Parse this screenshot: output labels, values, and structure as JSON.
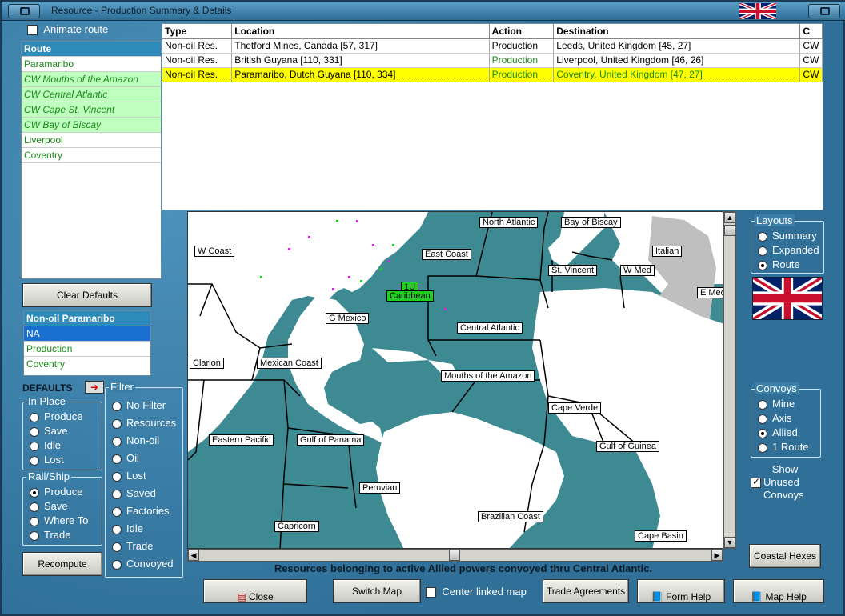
{
  "window": {
    "title": "Resource - Production Summary & Details"
  },
  "animate_route": {
    "label": "Animate route",
    "checked": false
  },
  "route_list": {
    "header": "Route",
    "items": [
      {
        "label": "Paramaribo",
        "style": "plain-green"
      },
      {
        "label": "CW Mouths of the Amazon",
        "style": "convoy"
      },
      {
        "label": "CW Central Atlantic",
        "style": "convoy"
      },
      {
        "label": "CW Cape St. Vincent",
        "style": "convoy"
      },
      {
        "label": "CW Bay of Biscay",
        "style": "convoy"
      },
      {
        "label": "Liverpool",
        "style": "plain-green"
      },
      {
        "label": "Coventry",
        "style": "plain-green"
      }
    ]
  },
  "table": {
    "columns": [
      "Type",
      "Location",
      "Action",
      "Destination",
      "C"
    ],
    "rows": [
      {
        "type": "Non-oil Res.",
        "location": "Thetford Mines, Canada [57, 317]",
        "action": "Production",
        "destination": "Leeds, United Kingdom [45, 27]",
        "c": "CW"
      },
      {
        "type": "Non-oil Res.",
        "location": "British Guyana [110, 331]",
        "action": "Production",
        "destination": "Liverpool, United Kingdom [46, 26]",
        "c": "CW"
      },
      {
        "type": "Non-oil Res.",
        "location": "Paramaribo, Dutch Guyana [110, 334]",
        "action": "Production",
        "destination": "Coventry, United Kingdom [47, 27]",
        "c": "CW"
      }
    ]
  },
  "clear_defaults": "Clear Defaults",
  "info_box": {
    "title": "Non-oil Paramaribo",
    "lines": [
      "NA",
      "Production",
      "Coventry"
    ]
  },
  "defaults_label": "DEFAULTS",
  "in_place": {
    "legend": "In Place",
    "options": [
      "Produce",
      "Save",
      "Idle",
      "Lost"
    ],
    "selected": -1
  },
  "rail_ship": {
    "legend": "Rail/Ship",
    "options": [
      "Produce",
      "Save",
      "Where To",
      "Trade"
    ],
    "selected": 0
  },
  "filter": {
    "legend": "Filter",
    "options": [
      "No Filter",
      "Resources",
      "Non-oil",
      "Oil",
      "Lost",
      "Saved",
      "Factories",
      "Idle",
      "Trade",
      "Convoyed"
    ],
    "selected": -1
  },
  "recompute": "Recompute",
  "layouts": {
    "legend": "Layouts",
    "options": [
      "Summary",
      "Expanded",
      "Route"
    ],
    "selected": 2
  },
  "convoys": {
    "legend": "Convoys",
    "options": [
      "Mine",
      "Axis",
      "Allied",
      "1 Route"
    ],
    "selected": 2
  },
  "show_unused": {
    "lines": [
      "Show",
      "Unused",
      "Convoys"
    ],
    "checked": true
  },
  "coastal_hexes": "Coastal Hexes",
  "status_text": "Resources belonging to active Allied powers convoyed thru Central Atlantic.",
  "bottom": {
    "close": "Close",
    "switch_map": "Switch Map",
    "center_linked": "Center linked map",
    "trade_agreements": "Trade Agreements",
    "form_help": "Form Help",
    "map_help": "Map Help"
  },
  "map_labels": {
    "north_atlantic": "North Atlantic",
    "bay_of_biscay": "Bay of Biscay",
    "w_coast": "W Coast",
    "east_coast": "East Coast",
    "italian": "Italian",
    "st_vincent": "St. Vincent",
    "w_med": "W Med",
    "e_med": "E Med",
    "caribbean_marker": "1U",
    "caribbean": "Caribbean",
    "g_mexico": "G Mexico",
    "central_atlantic": "Central Atlantic",
    "clarion": "Clarion",
    "mexican_coast": "Mexican Coast",
    "mouths_amazon": "Mouths of the Amazon",
    "cape_verde": "Cape Verde",
    "eastern_pacific": "Eastern Pacific",
    "gulf_of_panama": "Gulf of Panama",
    "gulf_of_guinea": "Gulf of Guinea",
    "peruvian": "Peruvian",
    "brazilian_coast": "Brazilian Coast",
    "capricorn": "Capricorn",
    "cape_basin": "Cape Basin"
  },
  "colors": {
    "sea": "#3e8a93",
    "land": "#ffffff",
    "neutral": "#bfbfbf",
    "highlight": "#ffff00",
    "convoy_bg": "#bfffbf"
  }
}
